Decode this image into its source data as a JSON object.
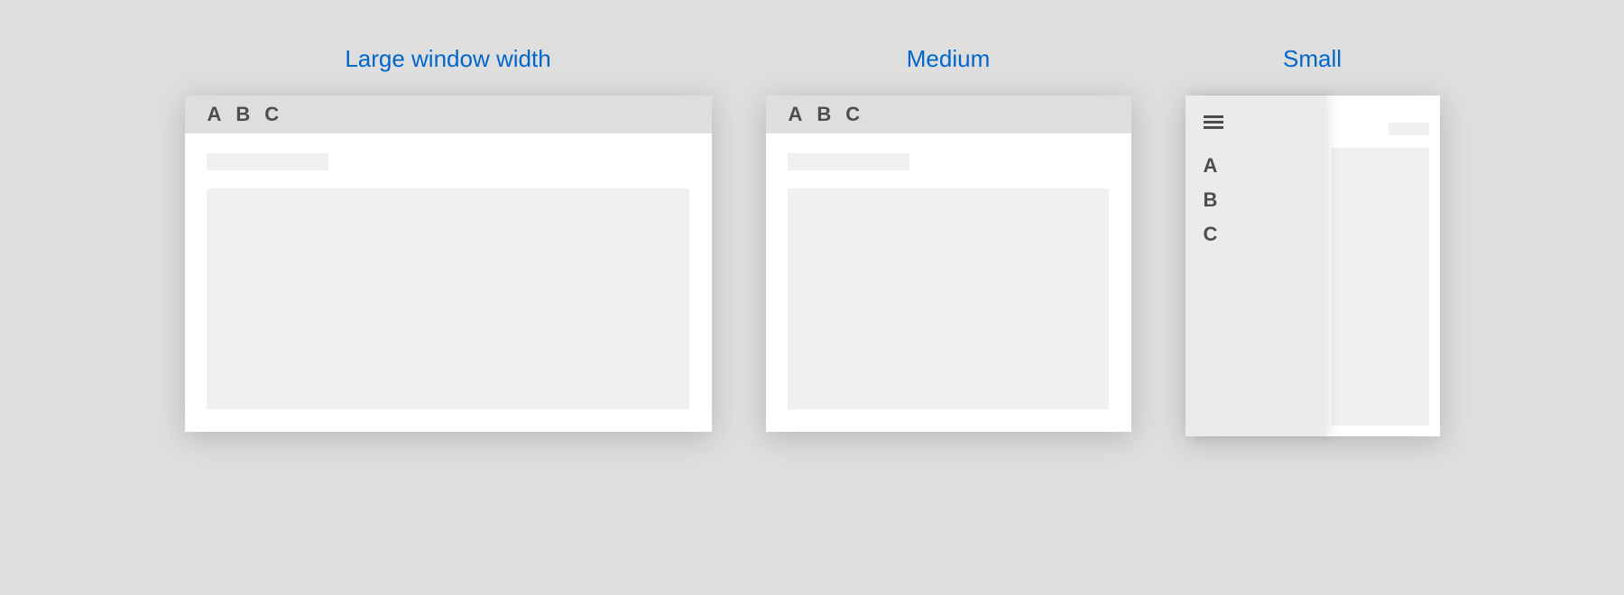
{
  "labels": {
    "large": "Large window width",
    "medium": "Medium",
    "small": "Small"
  },
  "tabs": {
    "a": "A",
    "b": "B",
    "c": "C"
  }
}
